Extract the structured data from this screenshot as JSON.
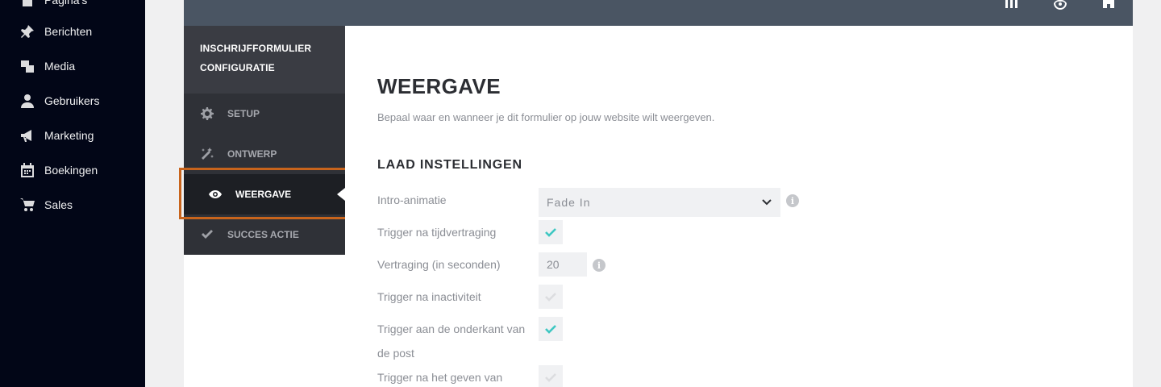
{
  "wp_menu": [
    {
      "label": "Pagina's",
      "icon": "page-icon"
    },
    {
      "label": "Berichten",
      "icon": "pin-icon"
    },
    {
      "label": "Media",
      "icon": "media-icon"
    },
    {
      "label": "Gebruikers",
      "icon": "user-icon"
    },
    {
      "label": "Marketing",
      "icon": "megaphone-icon"
    },
    {
      "label": "Boekingen",
      "icon": "calendar-icon"
    },
    {
      "label": "Sales",
      "icon": "cart-icon"
    }
  ],
  "topbar": {
    "icons": [
      "columns-icon",
      "account-icon",
      "home-icon"
    ]
  },
  "plugin_menu": {
    "title_line1": "INSCHRIJFFORMULIER",
    "title_line2": "CONFIGURATIE",
    "items": [
      {
        "label": "SETUP",
        "icon": "gear-icon",
        "active": false
      },
      {
        "label": "ONTWERP",
        "icon": "magic-wand-icon",
        "active": false
      },
      {
        "label": "WEERGAVE",
        "icon": "eye-icon",
        "active": true
      },
      {
        "label": "SUCCES ACTIE",
        "icon": "checkmark-icon",
        "active": false
      }
    ]
  },
  "main": {
    "title": "WEERGAVE",
    "subtitle": "Bepaal waar en wanneer je dit formulier op jouw website wilt weergeven.",
    "section_title": "LAAD INSTELLINGEN",
    "fields": {
      "intro_animation": {
        "label": "Intro-animatie",
        "value": "Fade In"
      },
      "trigger_delay": {
        "label": "Trigger na tijdvertraging",
        "checked": true
      },
      "delay_seconds": {
        "label": "Vertraging (in seconden)",
        "value": "20"
      },
      "trigger_inactivity": {
        "label": "Trigger na inactiviteit",
        "checked": false
      },
      "trigger_bottom": {
        "label": "Trigger aan de onderkant van de post",
        "checked": true
      },
      "trigger_comment": {
        "label": "Trigger na het geven van",
        "checked": false
      }
    }
  },
  "colors": {
    "accent_check": "#3ec7c2",
    "highlight": "#c8641c",
    "wp_sidebar": "#020617",
    "topbar": "#4a5563"
  }
}
